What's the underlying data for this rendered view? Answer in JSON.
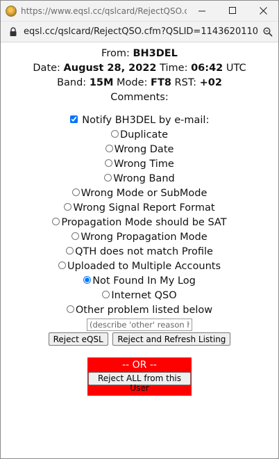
{
  "titlebar": {
    "url": "https://www.eqsl.cc/qslcard/RejectQSO.cfm..."
  },
  "addressbar": {
    "url": "eqsl.cc/qslcard/RejectQSO.cfm?QSLID=1143620110"
  },
  "qso": {
    "from_label": "From:",
    "from_call": "BH3DEL",
    "date_label": "Date:",
    "date": "August 28, 2022",
    "time_label": "Time:",
    "time": "06:42",
    "time_zone": "UTC",
    "band_label": "Band:",
    "band": "15M",
    "mode_label": "Mode:",
    "mode": "FT8",
    "rst_label": "RST:",
    "rst": "+02",
    "comments_label": "Comments:"
  },
  "notify": {
    "label": "Notify BH3DEL by e-mail:",
    "checked": true
  },
  "reasons": [
    {
      "label": "Duplicate"
    },
    {
      "label": "Wrong Date"
    },
    {
      "label": "Wrong Time"
    },
    {
      "label": "Wrong Band"
    },
    {
      "label": "Wrong Mode or SubMode"
    },
    {
      "label": "Wrong Signal Report Format"
    },
    {
      "label": "Propagation Mode should be SAT"
    },
    {
      "label": "Wrong Propagation Mode"
    },
    {
      "label": "QTH does not match Profile"
    },
    {
      "label": "Uploaded to Multiple Accounts"
    },
    {
      "label": "Not Found In My Log",
      "selected": true
    },
    {
      "label": "Internet QSO"
    },
    {
      "label": "Other problem listed below"
    }
  ],
  "other_reason": {
    "placeholder": "(describe 'other' reason her"
  },
  "buttons": {
    "reject": "Reject eQSL",
    "reject_refresh": "Reject and Refresh Listing",
    "or_text": "-- OR --",
    "reject_all": "Reject ALL from this User"
  },
  "colors": {
    "or_box_bg": "#ff0000",
    "or_text": "#ffffff"
  }
}
